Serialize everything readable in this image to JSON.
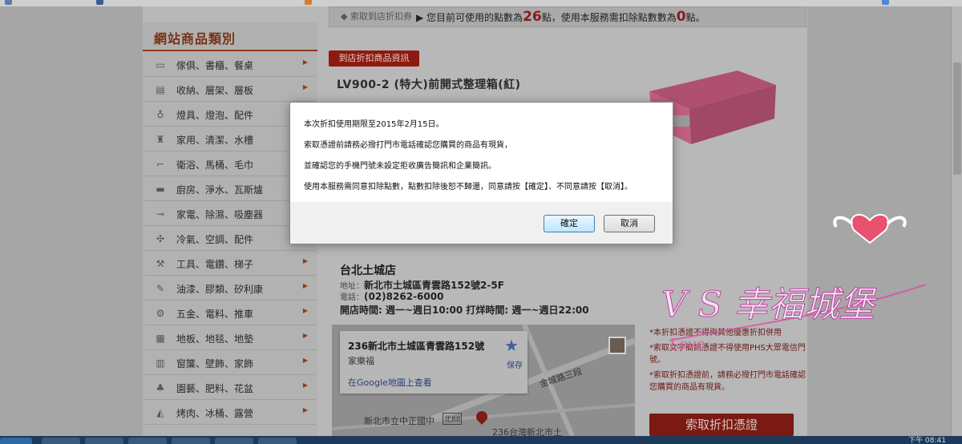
{
  "sidebar": {
    "title": "網站商品類別",
    "items": [
      {
        "label": "傢俱、書櫃、餐桌",
        "icon": "sofa-icon",
        "glyph": "▭"
      },
      {
        "label": "收納、層架、層板",
        "icon": "cabinet-icon",
        "glyph": "▤"
      },
      {
        "label": "燈具、燈泡、配件",
        "icon": "bulb-icon",
        "glyph": "♁"
      },
      {
        "label": "家用、清潔、水槽",
        "icon": "spray-icon",
        "glyph": "♜"
      },
      {
        "label": "衛浴、馬桶、毛巾",
        "icon": "toilet-icon",
        "glyph": "⌐"
      },
      {
        "label": "廚房、淨水、瓦斯爐",
        "icon": "stove-icon",
        "glyph": "▬"
      },
      {
        "label": "家電、除濕、吸塵器",
        "icon": "plug-icon",
        "glyph": "⊸"
      },
      {
        "label": "冷氣、空調、配件",
        "icon": "fan-icon",
        "glyph": "✣"
      },
      {
        "label": "工具、電鑽、梯子",
        "icon": "wrench-icon",
        "glyph": "⚒"
      },
      {
        "label": "油漆、膠類、矽利康",
        "icon": "brush-icon",
        "glyph": "✎"
      },
      {
        "label": "五金、電料、推車",
        "icon": "gear-icon",
        "glyph": "⚙"
      },
      {
        "label": "地板、地毯、地墊",
        "icon": "floor-icon",
        "glyph": "▦"
      },
      {
        "label": "窗簾、壁飾、家飾",
        "icon": "curtain-icon",
        "glyph": "▥"
      },
      {
        "label": "園藝、肥料、花盆",
        "icon": "plant-icon",
        "glyph": "♣"
      },
      {
        "label": "烤肉、冰桶、露營",
        "icon": "tent-icon",
        "glyph": "◭"
      }
    ]
  },
  "points_bar": {
    "tag": "索取到店折扣券",
    "msg_prefix": "您目前可使用的點數為",
    "points": "26",
    "msg_middle": "點，使用本服務需扣除點數數為",
    "deduct": "0",
    "msg_suffix": "點。"
  },
  "product": {
    "badge": "到店折扣商品資訊",
    "title": "LV900-2 (特大)前開式整理箱(紅)"
  },
  "store": {
    "name": "台北土城店",
    "addr_key": "地址：",
    "addr": "新北市土城區青雲路152號2-5F",
    "tel_key": "電話：",
    "tel": "(02)8262-6000",
    "hours": "開店時間: 週一~週日10:00 打烊時間: 週一~週日22:00"
  },
  "map": {
    "addr": "236新北市土城區青雲路152號",
    "sub": "家樂福",
    "link": "在Google地圖上查看",
    "save": "保存",
    "road1": "金城路三段",
    "road2": "新北市立中正國中",
    "road3": "北88",
    "road4": "236台灣新北市土"
  },
  "notes": [
    "*本折扣憑證不得與其他優惠折扣併用",
    "*索取文字簡訊憑證不得使用PHS大眾電信門號。",
    "*索取折扣憑證前，請務必撥打門市電話確認您購買的商品有現貨。"
  ],
  "claim_button": "索取折扣憑證",
  "dialog": {
    "lines": [
      "本次折扣使用期限至2015年2月15日。",
      "索取憑證前請務必撥打門市電話確認您購買的商品有現貨，",
      "並確認您的手機門號未設定拒收廣告簡訊和企業簡訊。",
      "使用本服務需同意扣除點數，點數扣除後恕不歸還，同意請按【確定】、不同意請按【取消】。"
    ],
    "ok": "確定",
    "cancel": "取消"
  },
  "watermark": {
    "text": "V S 幸福城堡",
    "sub": "Love"
  },
  "taskbar": {
    "clock": "下午 08:41"
  }
}
